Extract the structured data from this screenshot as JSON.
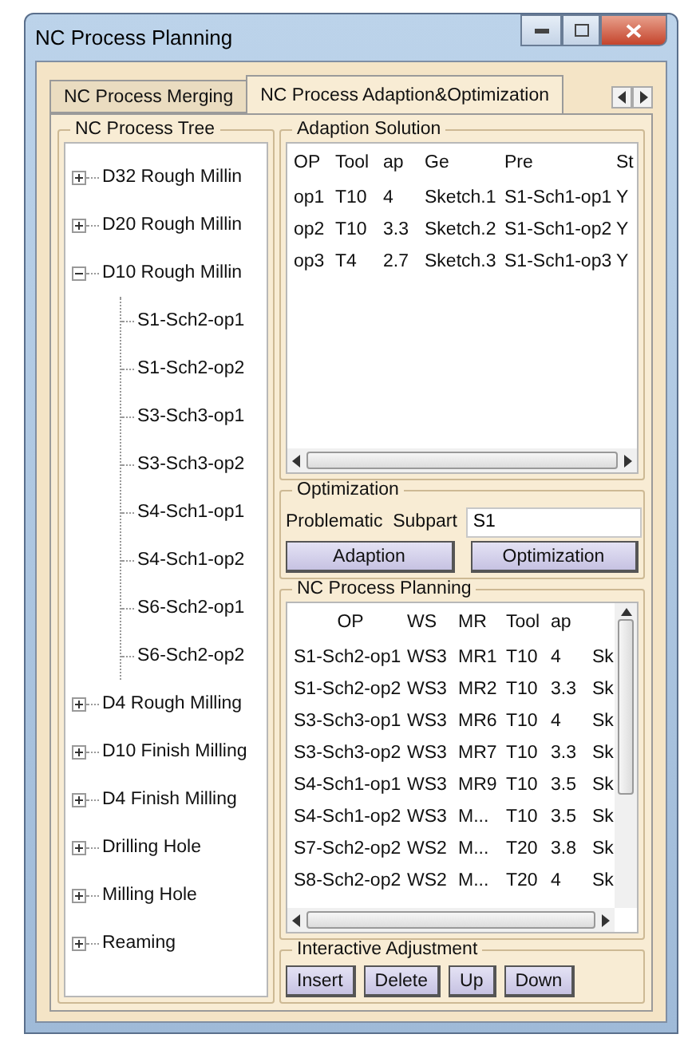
{
  "window": {
    "title": "NC Process Planning"
  },
  "tabs": [
    {
      "label": "NC Process Merging",
      "selected": false
    },
    {
      "label": "NC Process Adaption&Optimization",
      "selected": true
    }
  ],
  "tree": {
    "title": "NC Process Tree",
    "items": [
      {
        "label": "D32 Rough Millin",
        "expanded": false
      },
      {
        "label": "D20 Rough Millin",
        "expanded": false
      },
      {
        "label": "D10 Rough Millin",
        "expanded": true,
        "children": [
          {
            "label": "S1-Sch2-op1"
          },
          {
            "label": "S1-Sch2-op2"
          },
          {
            "label": "S3-Sch3-op1"
          },
          {
            "label": "S3-Sch3-op2"
          },
          {
            "label": "S4-Sch1-op1"
          },
          {
            "label": "S4-Sch1-op2"
          },
          {
            "label": "S6-Sch2-op1"
          },
          {
            "label": "S6-Sch2-op2"
          }
        ]
      },
      {
        "label": "D4 Rough Milling",
        "expanded": false
      },
      {
        "label": "D10 Finish Milling",
        "expanded": false
      },
      {
        "label": "D4 Finish Milling",
        "expanded": false
      },
      {
        "label": "Drilling Hole",
        "expanded": false
      },
      {
        "label": "Milling Hole",
        "expanded": false
      },
      {
        "label": "Reaming",
        "expanded": false
      }
    ]
  },
  "adaption_solution": {
    "title": "Adaption Solution",
    "columns": [
      "OP",
      "Tool",
      "ap",
      "Ge",
      "Pre",
      "St"
    ],
    "rows": [
      [
        "op1",
        "T10",
        "4",
        "Sketch.1",
        "S1-Sch1-op1",
        "Y"
      ],
      [
        "op2",
        "T10",
        "3.3",
        "Sketch.2",
        "S1-Sch1-op2",
        "Y"
      ],
      [
        "op3",
        "T4",
        "2.7",
        "Sketch.3",
        "S1-Sch1-op3",
        "Y"
      ]
    ]
  },
  "optimization": {
    "title": "Optimization",
    "subpart_label": "Problematic  Subpart",
    "subpart_value": "S1",
    "buttons": [
      "Adaption",
      "Optimization"
    ]
  },
  "planning": {
    "title": "NC Process Planning",
    "columns": [
      "OP",
      "WS",
      "MR",
      "Tool",
      "ap"
    ],
    "rows": [
      [
        "S1-Sch2-op1",
        "WS3",
        "MR1",
        "T10",
        "4",
        "Sk"
      ],
      [
        "S1-Sch2-op2",
        "WS3",
        "MR2",
        "T10",
        "3.3",
        "Sk"
      ],
      [
        "S3-Sch3-op1",
        "WS3",
        "MR6",
        "T10",
        "4",
        "Sk"
      ],
      [
        "S3-Sch3-op2",
        "WS3",
        "MR7",
        "T10",
        "3.3",
        "Sk"
      ],
      [
        "S4-Sch1-op1",
        "WS3",
        "MR9",
        "T10",
        "3.5",
        "Sk"
      ],
      [
        "S4-Sch1-op2",
        "WS3",
        "M...",
        "T10",
        "3.5",
        "Sk"
      ],
      [
        "S7-Sch2-op2",
        "WS2",
        "M...",
        "T20",
        "3.8",
        "Sk"
      ],
      [
        "S8-Sch2-op2",
        "WS2",
        "M...",
        "T20",
        "4",
        "Sk"
      ]
    ]
  },
  "adjustment": {
    "title": "Interactive  Adjustment",
    "buttons": [
      "Insert",
      "Delete",
      "Up",
      "Down"
    ]
  }
}
